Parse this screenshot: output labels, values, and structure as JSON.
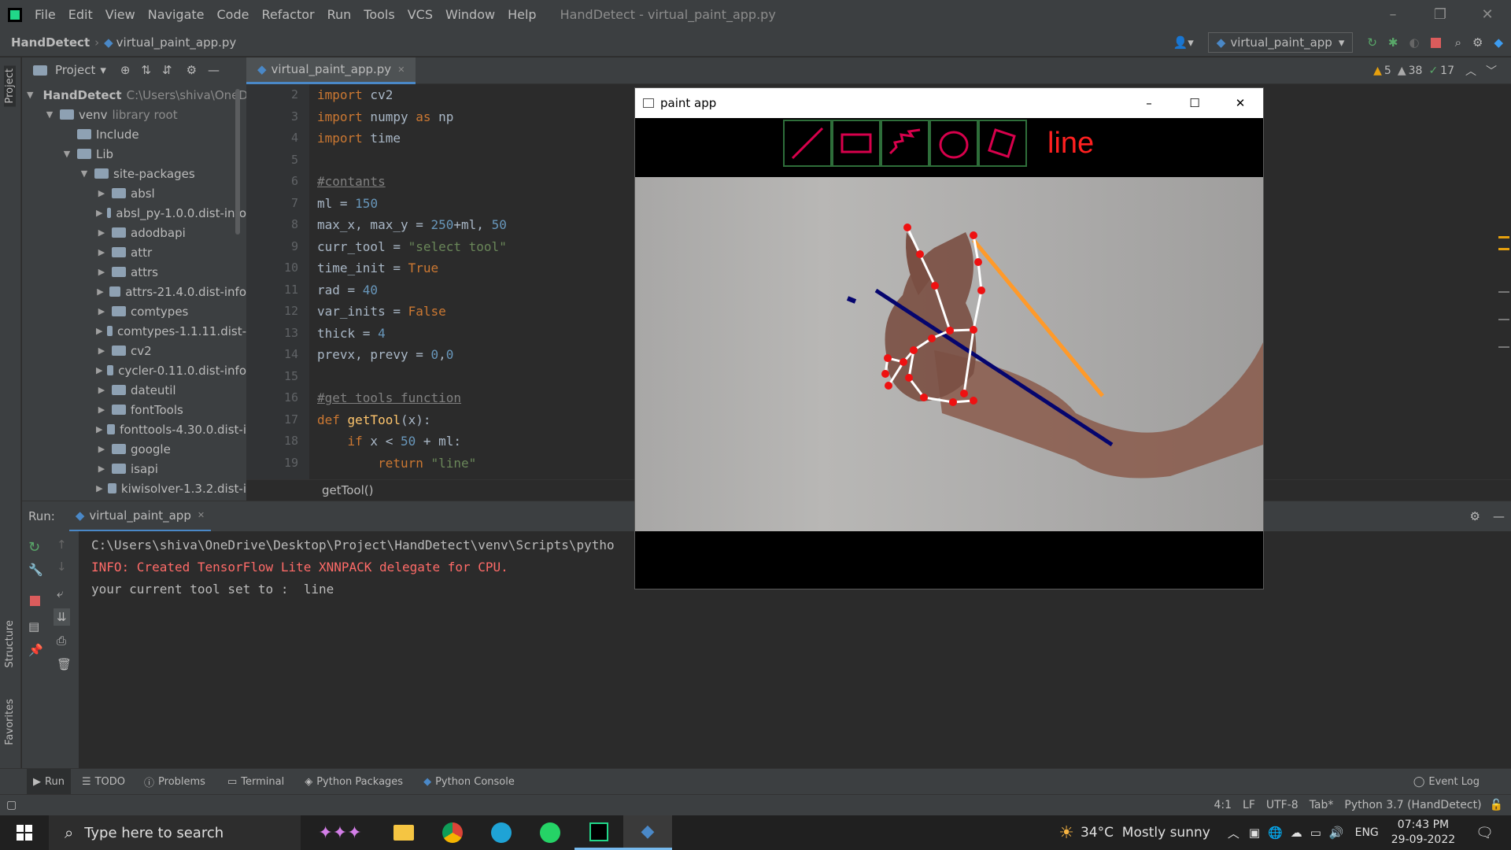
{
  "titlebar": {
    "menu": [
      "File",
      "Edit",
      "View",
      "Navigate",
      "Code",
      "Refactor",
      "Run",
      "Tools",
      "VCS",
      "Window",
      "Help"
    ],
    "window_title": "HandDetect - virtual_paint_app.py"
  },
  "navbar": {
    "project": "HandDetect",
    "file": "virtual_paint_app.py",
    "run_config": "virtual_paint_app"
  },
  "left_stripe": {
    "project_label": "Project",
    "structure_label": "Structure",
    "favorites_label": "Favorites"
  },
  "project_panel": {
    "title": "Project",
    "root_name": "HandDetect",
    "root_path": "C:\\Users\\shiva\\OneDr",
    "items": [
      {
        "label": "venv",
        "hint": "library root",
        "depth": 1,
        "open": true
      },
      {
        "label": "Include",
        "depth": 2,
        "open": false,
        "leaf": true
      },
      {
        "label": "Lib",
        "depth": 2,
        "open": true
      },
      {
        "label": "site-packages",
        "depth": 3,
        "open": true
      },
      {
        "label": "absl",
        "depth": 4
      },
      {
        "label": "absl_py-1.0.0.dist-info",
        "depth": 4
      },
      {
        "label": "adodbapi",
        "depth": 4
      },
      {
        "label": "attr",
        "depth": 4
      },
      {
        "label": "attrs",
        "depth": 4
      },
      {
        "label": "attrs-21.4.0.dist-info",
        "depth": 4
      },
      {
        "label": "comtypes",
        "depth": 4
      },
      {
        "label": "comtypes-1.1.11.dist-",
        "depth": 4
      },
      {
        "label": "cv2",
        "depth": 4
      },
      {
        "label": "cycler-0.11.0.dist-info",
        "depth": 4
      },
      {
        "label": "dateutil",
        "depth": 4
      },
      {
        "label": "fontTools",
        "depth": 4
      },
      {
        "label": "fonttools-4.30.0.dist-i",
        "depth": 4
      },
      {
        "label": "google",
        "depth": 4
      },
      {
        "label": "isapi",
        "depth": 4
      },
      {
        "label": "kiwisolver-1.3.2.dist-i",
        "depth": 4
      }
    ]
  },
  "editor": {
    "tab": "virtual_paint_app.py",
    "line_numbers": [
      "2",
      "3",
      "4",
      "5",
      "6",
      "7",
      "8",
      "9",
      "10",
      "11",
      "12",
      "13",
      "14",
      "15",
      "16",
      "17",
      "18",
      "19"
    ],
    "inspections": {
      "warnings": "5",
      "weak": "38",
      "ok": "17"
    },
    "breadcrumb": "getTool()"
  },
  "run_panel": {
    "label": "Run:",
    "tab": "virtual_paint_app",
    "lines": [
      "C:\\Users\\shiva\\OneDrive\\Desktop\\Project\\HandDetect\\venv\\Scripts\\pytho",
      "INFO: Created TensorFlow Lite XNNPACK delegate for CPU.",
      "your current tool set to :  line"
    ]
  },
  "tool_tabs": [
    "Run",
    "TODO",
    "Problems",
    "Terminal",
    "Python Packages",
    "Python Console"
  ],
  "event_log": "Event Log",
  "status": {
    "position": "4:1",
    "line_sep": "LF",
    "encoding": "UTF-8",
    "indent": "Tab*",
    "interpreter": "Python 3.7 (HandDetect)"
  },
  "paint_app": {
    "title": "paint app",
    "current_tool": "line",
    "tools": [
      "line",
      "rectangle",
      "draw",
      "circle",
      "erase"
    ]
  },
  "taskbar": {
    "search_placeholder": "Type here to search",
    "weather": "34°C  Mostly sunny",
    "lang": "ENG",
    "time": "07:43 PM",
    "date": "29-09-2022"
  }
}
